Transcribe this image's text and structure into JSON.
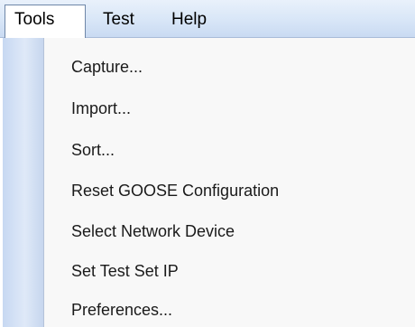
{
  "menubar": {
    "items": [
      {
        "label": "Tools",
        "active": true
      },
      {
        "label": "Test",
        "active": false
      },
      {
        "label": "Help",
        "active": false
      }
    ]
  },
  "tools_menu": {
    "items": [
      {
        "label": "Capture..."
      },
      {
        "label": "Import..."
      },
      {
        "label": "Sort..."
      },
      {
        "label": "Reset GOOSE Configuration"
      },
      {
        "label": "Select Network Device"
      },
      {
        "label": "Set Test Set IP"
      },
      {
        "label": "Preferences..."
      }
    ]
  },
  "colors": {
    "menubar_bg": "#d8e6f7",
    "gutter": "#c7d8f2",
    "menu_bg": "#f8f8f8"
  }
}
